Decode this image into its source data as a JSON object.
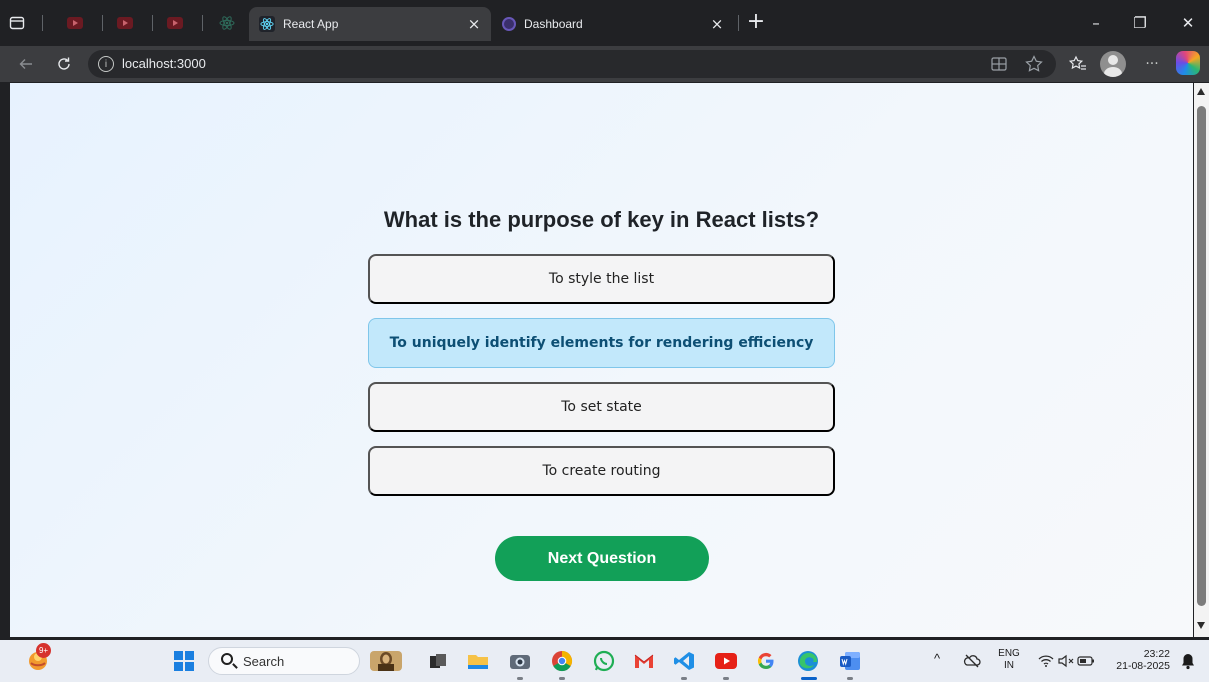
{
  "browser": {
    "tabs": [
      {
        "title": "React App",
        "close": "×",
        "active": true
      },
      {
        "title": "Dashboard",
        "close": "×",
        "active": false
      }
    ],
    "new_tab": "+",
    "window_controls": {
      "minimize": "–",
      "restore": "❐",
      "close": "✕"
    },
    "address": {
      "url": "localhost:3000",
      "info": "i"
    },
    "toolbar_icons": [
      "back-icon",
      "reload-icon",
      "split-screen-icon",
      "favorite-icon",
      "favorites-list-icon",
      "profile-icon",
      "more-icon",
      "copilot-icon"
    ],
    "more": "···"
  },
  "quiz": {
    "question": "What is the purpose of key in React lists?",
    "options": [
      {
        "label": "To style the list",
        "selected": false
      },
      {
        "label": "To uniquely identify elements for rendering efficiency",
        "selected": true
      },
      {
        "label": "To set state",
        "selected": false
      },
      {
        "label": "To create routing",
        "selected": false
      }
    ],
    "next_button": "Next Question"
  },
  "taskbar": {
    "notification_badge": "9+",
    "search_label": "Search",
    "apps": [
      "start-icon",
      "search-icon",
      "mona-lisa-icon",
      "task-view-icon",
      "file-explorer-icon",
      "camera-icon",
      "chrome-icon",
      "whatsapp-icon",
      "gmail-icon",
      "vscode-icon",
      "youtube-icon",
      "google-icon",
      "edge-icon",
      "word-icon"
    ],
    "tray": {
      "chevron": "^",
      "language": "ENG",
      "region": "IN",
      "time": "23:22",
      "date": "21-08-2025"
    }
  },
  "colors": {
    "accent_green": "#12a058",
    "selected_bg": "#c2e8fb",
    "selected_text": "#0d4f74"
  }
}
